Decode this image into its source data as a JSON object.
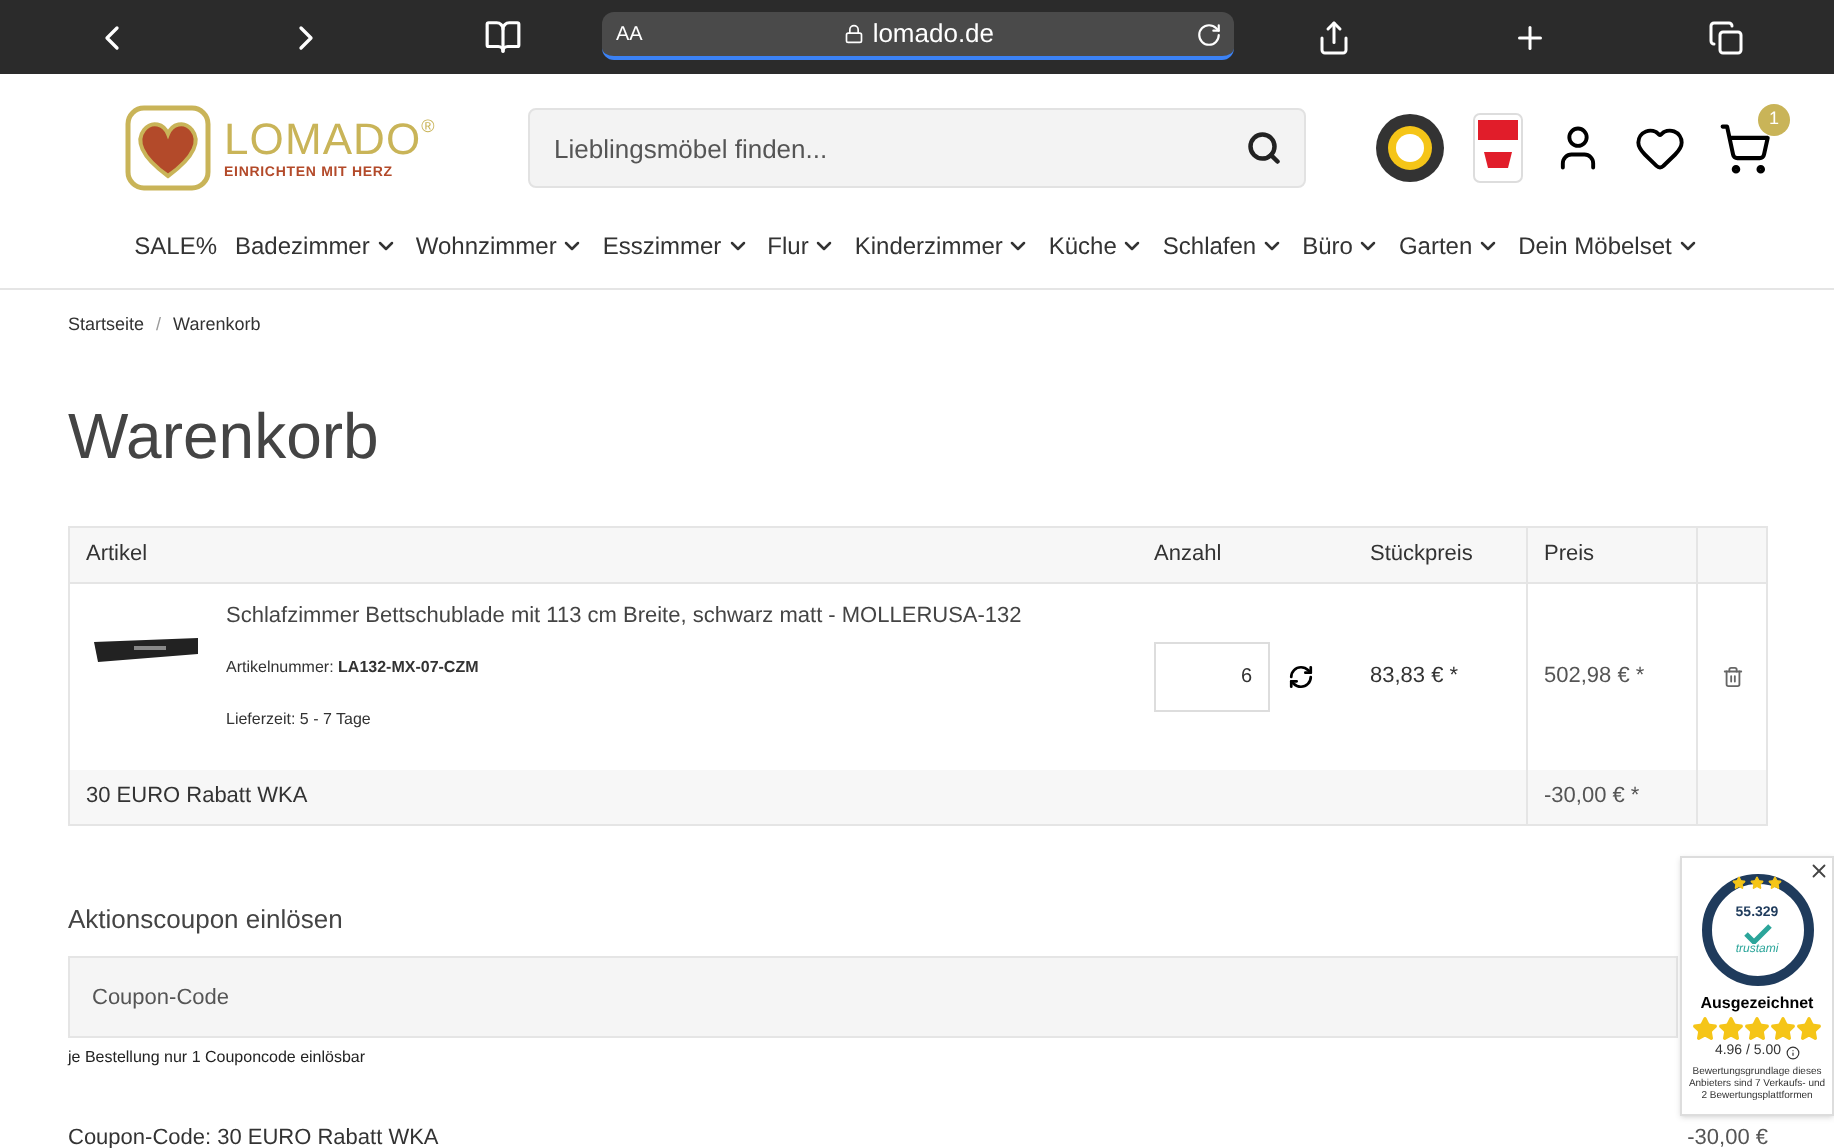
{
  "browser": {
    "text_size_button": "AA",
    "address": "lomado.de"
  },
  "logo": {
    "name": "LOMADO",
    "registered": "®",
    "tagline": "EINRICHTEN MIT HERZ"
  },
  "search": {
    "placeholder": "Lieblingsmöbel finden..."
  },
  "cart": {
    "count": "1"
  },
  "nav": [
    {
      "label": "SALE%",
      "dropdown": false
    },
    {
      "label": "Badezimmer",
      "dropdown": true
    },
    {
      "label": "Wohnzimmer",
      "dropdown": true
    },
    {
      "label": "Esszimmer",
      "dropdown": true
    },
    {
      "label": "Flur",
      "dropdown": true
    },
    {
      "label": "Kinderzimmer",
      "dropdown": true
    },
    {
      "label": "Küche",
      "dropdown": true
    },
    {
      "label": "Schlafen",
      "dropdown": true
    },
    {
      "label": "Büro",
      "dropdown": true
    },
    {
      "label": "Garten",
      "dropdown": true
    },
    {
      "label": "Dein Möbelset",
      "dropdown": true
    }
  ],
  "breadcrumb": [
    "Startseite",
    "Warenkorb"
  ],
  "breadcrumb_separator": "/",
  "page_title": "Warenkorb",
  "table": {
    "columns": [
      "Artikel",
      "Anzahl",
      "Stückpreis",
      "Preis"
    ],
    "item": {
      "title": "Schlafzimmer Bettschublade mit 113 cm Breite, schwarz matt - MOLLERUSA-132",
      "sku_label": "Artikelnummer:",
      "sku": "LA132-MX-07-CZM",
      "delivery_label": "Lieferzeit:",
      "delivery": "5 - 7 Tage",
      "quantity": "6",
      "unit_price": "83,83 € *",
      "price": "502,98 € *"
    },
    "discount": {
      "label": "30 EURO Rabatt WKA",
      "price": "-30,00 € *"
    }
  },
  "coupon": {
    "title": "Aktionscoupon einlösen",
    "placeholder": "Coupon-Code",
    "note": "je Bestellung nur 1 Couponcode einlösbar",
    "applied": "Coupon-Code: 30 EURO Rabatt WKA",
    "applied_amount": "-30,00 €"
  },
  "trust_widget": {
    "count": "55.329",
    "brand": "trustami",
    "rating_label": "Ausgezeichnet",
    "stars": 5,
    "score": "4.96 / 5.00",
    "basis": "Bewertungsgrundlage dieses Anbieters sind 7 Verkaufs- und 2 Bewertungsplattformen"
  }
}
